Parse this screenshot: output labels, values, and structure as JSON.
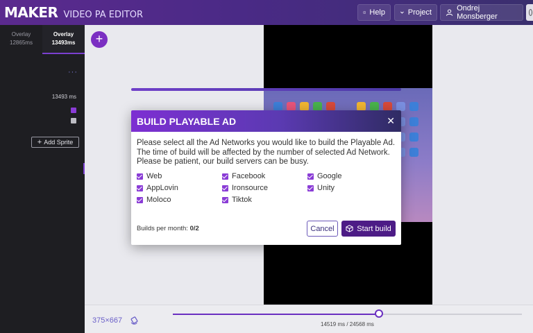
{
  "header": {
    "brand": "MAKER",
    "subtitle": "VIDEO PA EDITOR",
    "help_label": "Help",
    "project_label": "Project",
    "user_name": "Ondrej Monsberger"
  },
  "sidebar": {
    "tabs": [
      {
        "line1": "Overlay",
        "line2": "12865ms"
      },
      {
        "line1": "Overlay",
        "line2": "13493ms"
      }
    ],
    "menu_dots": "···",
    "duration": "13493 ms",
    "add_sprite_label": "Add Sprite"
  },
  "canvas": {
    "add_button": "+"
  },
  "modal": {
    "title": "BUILD PLAYABLE AD",
    "close": "✕",
    "description": "Please select all the Ad Networks you would like to build the Playable Ad. The time of build will be affected by the number of selected Ad Network. Please be patient, our build servers can be busy.",
    "networks": [
      {
        "label": "Web",
        "checked": true
      },
      {
        "label": "Facebook",
        "checked": true
      },
      {
        "label": "Google",
        "checked": true
      },
      {
        "label": "AppLovin",
        "checked": true
      },
      {
        "label": "Ironsource",
        "checked": true
      },
      {
        "label": "Unity",
        "checked": true
      },
      {
        "label": "Moloco",
        "checked": true
      },
      {
        "label": "Tiktok",
        "checked": true
      }
    ],
    "builds_label": "Builds per month:",
    "builds_value": "0/2",
    "cancel_label": "Cancel",
    "start_label": "Start build"
  },
  "bottombar": {
    "resolution": "375×667",
    "time_readout": "14519 ms / 24568 ms",
    "progress": 0.591
  },
  "colors": {
    "accent": "#7b2fc2",
    "header_start": "#5b2a8e",
    "start_button": "#4d1c86"
  }
}
